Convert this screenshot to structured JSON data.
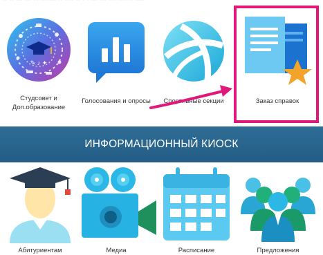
{
  "top_strip": {
    "text": "·· ·· ··· ··· ·· ······· ·· ···· ·· · · ··· ··· ··· ···· ·· ····"
  },
  "row1": [
    {
      "id": "studsovet",
      "label_line1": "Студсовет  и",
      "label_line2": "Доп.образование",
      "icon": "student-council-icon"
    },
    {
      "id": "voting",
      "label_line1": "Голосования и опросы",
      "label_line2": "",
      "icon": "poll-chart-icon"
    },
    {
      "id": "sport",
      "label_line1": "Спортивные секции",
      "label_line2": "",
      "icon": "volleyball-icon"
    },
    {
      "id": "certificates",
      "label_line1": "Заказ справок",
      "label_line2": "",
      "icon": "documents-star-icon"
    }
  ],
  "banner": {
    "title": "ИНФОРМАЦИОННЫЙ КИОСК"
  },
  "row2": [
    {
      "id": "applicants",
      "label": "Абитуриентам",
      "icon": "graduate-icon"
    },
    {
      "id": "media",
      "label": "Медиа",
      "icon": "movie-camera-icon"
    },
    {
      "id": "schedule",
      "label": "Расписание",
      "icon": "calendar-icon"
    },
    {
      "id": "suggestions",
      "label": "Предложения",
      "icon": "people-group-icon"
    }
  ],
  "colors": {
    "banner": "#2a6690",
    "accent_cyan": "#29b6e8",
    "annotation": "#e0187a",
    "star": "#f4a32a"
  }
}
